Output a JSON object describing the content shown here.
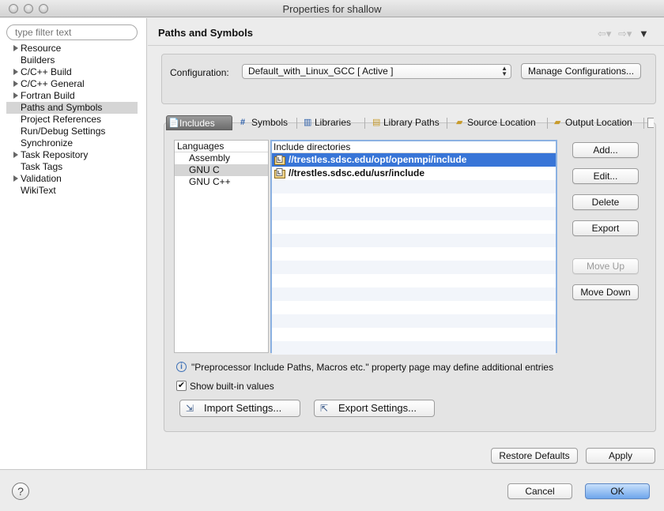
{
  "window": {
    "title": "Properties for shallow"
  },
  "sidebar": {
    "filter_placeholder": "type filter text",
    "items": [
      {
        "label": "Resource",
        "expandable": true
      },
      {
        "label": "Builders",
        "expandable": false
      },
      {
        "label": "C/C++ Build",
        "expandable": true
      },
      {
        "label": "C/C++ General",
        "expandable": true
      },
      {
        "label": "Fortran Build",
        "expandable": true
      },
      {
        "label": "Paths and Symbols",
        "expandable": false,
        "selected": true
      },
      {
        "label": "Project References",
        "expandable": false
      },
      {
        "label": "Run/Debug Settings",
        "expandable": false
      },
      {
        "label": "Synchronize",
        "expandable": false
      },
      {
        "label": "Task Repository",
        "expandable": true
      },
      {
        "label": "Task Tags",
        "expandable": false
      },
      {
        "label": "Validation",
        "expandable": true
      },
      {
        "label": "WikiText",
        "expandable": false
      }
    ]
  },
  "page": {
    "title": "Paths and Symbols",
    "configuration": {
      "label": "Configuration:",
      "value": "Default_with_Linux_GCC  [ Active ]",
      "manage_button": "Manage Configurations..."
    },
    "tabs": [
      {
        "label": "Includes",
        "icon": "include-icon",
        "active": true
      },
      {
        "label": "Symbols",
        "icon": "hash-icon"
      },
      {
        "label": "Libraries",
        "icon": "library-icon"
      },
      {
        "label": "Library Paths",
        "icon": "library-path-icon"
      },
      {
        "label": "Source Location",
        "icon": "folder-icon"
      },
      {
        "label": "Output Location",
        "icon": "folder-icon"
      }
    ],
    "languages": {
      "header": "Languages",
      "items": [
        "Assembly",
        "GNU C",
        "GNU C++"
      ],
      "selected_index": 1
    },
    "include_dirs": {
      "header": "Include directories",
      "items": [
        "//trestles.sdsc.edu/opt/openmpi/include",
        "//trestles.sdsc.edu/usr/include"
      ],
      "selected_index": 0
    },
    "side_buttons": {
      "add": "Add...",
      "edit": "Edit...",
      "delete": "Delete",
      "export": "Export",
      "move_up": "Move Up",
      "move_down": "Move Down"
    },
    "info_text": "\"Preprocessor Include Paths, Macros etc.\" property page may define additional entries",
    "show_builtin": {
      "label": "Show built-in values",
      "checked": true
    },
    "import_button": "Import Settings...",
    "export_button": "Export Settings...",
    "restore_defaults": "Restore Defaults",
    "apply": "Apply"
  },
  "footer": {
    "cancel": "Cancel",
    "ok": "OK"
  },
  "colors": {
    "selection": "#3875d7",
    "default_button": "#6fa6ec"
  }
}
